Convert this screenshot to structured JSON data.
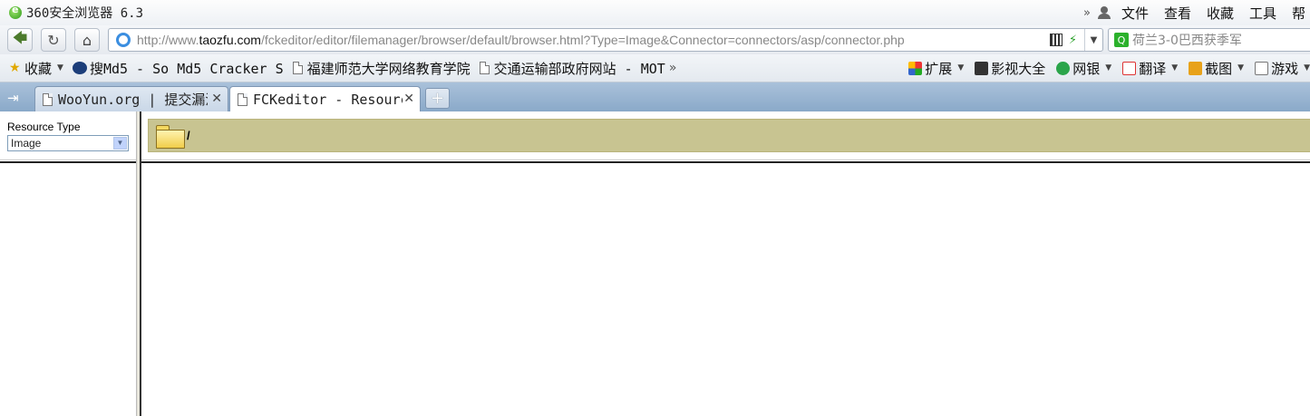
{
  "window": {
    "title": "360安全浏览器 6.3",
    "menu_more": "»",
    "menu": [
      "文件",
      "查看",
      "收藏",
      "工具",
      "帮"
    ]
  },
  "address_bar": {
    "url_prefix": "http://www.",
    "url_host": "taozfu.com",
    "url_path": "/fckeditor/editor/filemanager/browser/default/browser.html?Type=Image&Connector=connectors/asp/connector.php",
    "search_placeholder": "荷兰3-0巴西获季军",
    "search_icon_glyph": "Q"
  },
  "bookmarks": {
    "favorites_label": "收藏",
    "items": [
      "搜Md5 - So Md5 Cracker S",
      "福建师范大学网络教育学院",
      "交通运输部政府网站 - MOT"
    ],
    "more": "»"
  },
  "toolbar": {
    "extensions": "扩展",
    "video": "影视大全",
    "bank": "网银",
    "translate": "翻译",
    "screenshot": "截图",
    "games": "游戏"
  },
  "tabs": [
    {
      "title": "WooYun.org | 提交漏洞",
      "active": false
    },
    {
      "title": "FCKeditor - Resource",
      "active": true
    }
  ],
  "new_tab_label": "+",
  "filemanager": {
    "resource_type_label": "Resource Type",
    "resource_type_value": "Image",
    "current_folder": "/"
  },
  "colors": {
    "folder_bar": "#c8c491",
    "tab_strip": "#9fb7d1",
    "accent_green": "#2e9a1a"
  }
}
